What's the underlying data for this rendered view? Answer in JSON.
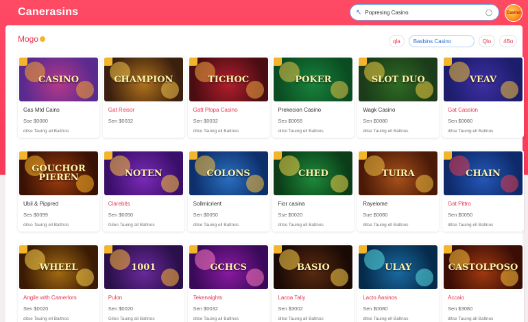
{
  "header": {
    "brand": "Canerasins",
    "search_label": "Popresing Casino",
    "avatar_label": "Casino"
  },
  "subheader": {
    "title": "Mogo",
    "filter_left": "qla",
    "filter_field": "Basbins Casino",
    "filter_right1": "Qlo",
    "filter_right2": "4Bo"
  },
  "cards": [
    {
      "title": "Gas Mtd Cains",
      "title_red": false,
      "price": "Sse $0080",
      "sub": "ditse Tauing all Baltnos",
      "art": "CASINO"
    },
    {
      "title": "Gat Reisor",
      "title_red": true,
      "price": "Sen $0032",
      "sub": "",
      "art": "CHAMPION"
    },
    {
      "title": "Gatt Plopa Casino",
      "title_red": true,
      "price": "Sen $0032",
      "sub": "ditso Tauing ell Baltnos",
      "art": "TICHOC"
    },
    {
      "title": "Prekecion Casino",
      "title_red": false,
      "price": "Ses $0055",
      "sub": "ditso Tauing ell Baltnos",
      "art": "POKER"
    },
    {
      "title": "Wagk Casino",
      "title_red": false,
      "price": "Sen $0080",
      "sub": "ditse Tauing ell Baltnos",
      "art": "SLOT DUO"
    },
    {
      "title": "Gat Cassion",
      "title_red": true,
      "price": "Sen $0080",
      "sub": "ditse Tauing ell Baltnos",
      "art": "VEAV"
    },
    {
      "title": "Ubil & Pippred",
      "title_red": false,
      "price": "Ses $0099",
      "sub": "ditso Tauing ell Baltnos",
      "art": "GOUCHOR PIEREN"
    },
    {
      "title": "Clarebits",
      "title_red": true,
      "price": "Sen $0050",
      "sub": "Gileo Tauing all Baltnos",
      "art": "NOTEN"
    },
    {
      "title": "Sollmicrient",
      "title_red": false,
      "price": "Sen $0050",
      "sub": "ditse Tauing ell Baltnos",
      "art": "COLONS"
    },
    {
      "title": "Fior casina",
      "title_red": false,
      "price": "Sse $0020",
      "sub": "ditse Tauing all Baltnos",
      "art": "CHED"
    },
    {
      "title": "Rayelome",
      "title_red": false,
      "price": "Sue $0080",
      "sub": "ditse Tauing ell Baltnos",
      "art": "TUIRA"
    },
    {
      "title": "Gat Pittro",
      "title_red": true,
      "price": "Sen $0050",
      "sub": "ditse Tauing ell Baltnos",
      "art": "CHAIN"
    },
    {
      "title": "Angile with Camerlors",
      "title_red": true,
      "price": "Sen $0020",
      "sub": "ditse Tauing ell Baltnos",
      "art": "WHEEL"
    },
    {
      "title": "Pulon",
      "title_red": true,
      "price": "Sen $0020",
      "sub": "Gileo Tauing all Baltnos",
      "art": "1001"
    },
    {
      "title": "Tekenaights",
      "title_red": true,
      "price": "Sen $0032",
      "sub": "ditse Tauing all Baltnos",
      "art": "GCHCS"
    },
    {
      "title": "Lacoa Taliy",
      "title_red": true,
      "price": "Sen $3002",
      "sub": "ditse Tauing all Baltnos",
      "art": "BASIO"
    },
    {
      "title": "Lacto Aasinos",
      "title_red": true,
      "price": "Sen $0080",
      "sub": "ditse Tauing ell Baltnos",
      "art": "ULAY"
    },
    {
      "title": "Accaio",
      "title_red": true,
      "price": "Sen $3080",
      "sub": "ditse Tauing all Baltnos",
      "art": "CASTOLPOSO"
    }
  ],
  "thumb_colors": [
    [
      "#5a2a8f",
      "#b5388a",
      "#f5a52a"
    ],
    [
      "#3b1f0f",
      "#b0731c",
      "#f2c34a"
    ],
    [
      "#4a0d12",
      "#b21e2d",
      "#f0a640"
    ],
    [
      "#0b4d22",
      "#17833c",
      "#e6c44a"
    ],
    [
      "#1b3b1a",
      "#2e6b22",
      "#f1d040"
    ],
    [
      "#1c1d6b",
      "#3e2fa3",
      "#f5c23a"
    ],
    [
      "#3a1205",
      "#9c3d0d",
      "#ffb727"
    ],
    [
      "#3a0f6a",
      "#7b2ab8",
      "#ffc43e"
    ],
    [
      "#0d2f6b",
      "#2a6fc0",
      "#ffc23a"
    ],
    [
      "#0a3d18",
      "#1f8a3a",
      "#f4d24a"
    ],
    [
      "#4a1a07",
      "#a8511a",
      "#f4c042"
    ],
    [
      "#0e2a6a",
      "#2458b8",
      "#e53c4e"
    ],
    [
      "#3a1a05",
      "#a26a12",
      "#ffd34a"
    ],
    [
      "#2a0f4a",
      "#6a2a9a",
      "#ffb83a"
    ],
    [
      "#3a0a5a",
      "#8a1aa0",
      "#ff7ac0"
    ],
    [
      "#1a0a05",
      "#5a2a10",
      "#ffd24a"
    ],
    [
      "#052a4a",
      "#1a6aa0",
      "#5adfe6"
    ],
    [
      "#3a0d05",
      "#a03a10",
      "#ffc23a"
    ]
  ]
}
